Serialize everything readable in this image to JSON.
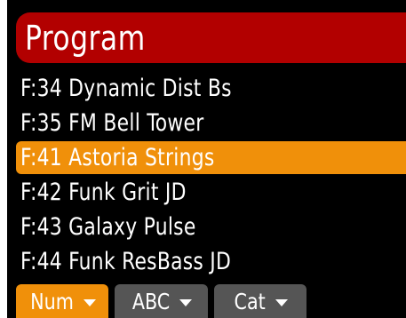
{
  "header": {
    "title": "Program"
  },
  "programs": [
    {
      "label": "F:34 Dynamic Dist Bs",
      "selected": false
    },
    {
      "label": "F:35 FM Bell Tower",
      "selected": false
    },
    {
      "label": "F:41 Astoria Strings",
      "selected": true
    },
    {
      "label": "F:42 Funk Grit JD",
      "selected": false
    },
    {
      "label": "F:43 Galaxy Pulse",
      "selected": false
    },
    {
      "label": "F:44 Funk ResBass JD",
      "selected": false
    }
  ],
  "tabs": [
    {
      "label": "Num",
      "active": true
    },
    {
      "label": "ABC",
      "active": false
    },
    {
      "label": "Cat",
      "active": false
    }
  ],
  "colors": {
    "background": "#000000",
    "header": "#b20000",
    "selection": "#f0900a",
    "tab_inactive": "#555555",
    "text": "#ffffff"
  },
  "icons": {
    "tab_dropdown": "caret-down-icon"
  }
}
